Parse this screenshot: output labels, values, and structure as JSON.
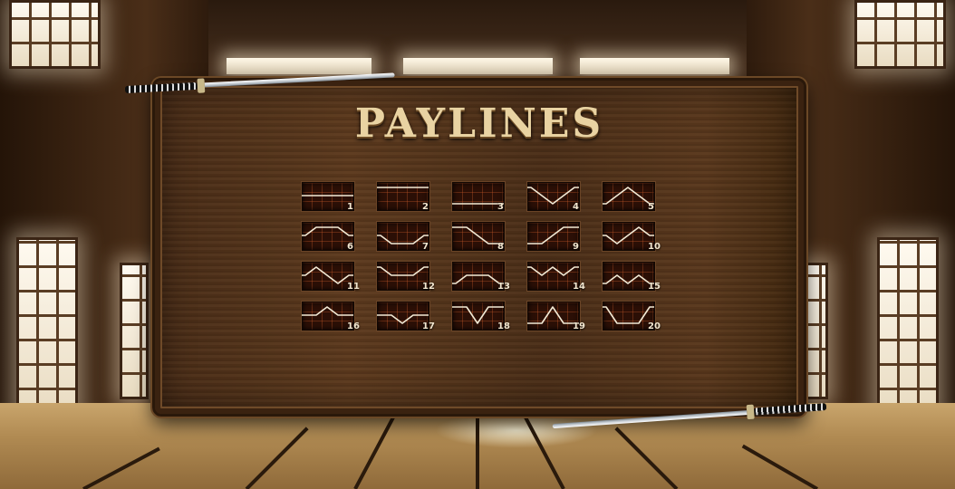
{
  "title": "PAYLINES",
  "colors": {
    "title": "#e9d3a2",
    "line": "#f3ead5",
    "box": "#2b0f06",
    "grid": "#c85a28"
  },
  "paylines": [
    {
      "label": "1",
      "pattern": [
        1,
        1,
        1,
        1,
        1
      ]
    },
    {
      "label": "2",
      "pattern": [
        0,
        0,
        0,
        0,
        0
      ]
    },
    {
      "label": "3",
      "pattern": [
        2,
        2,
        2,
        2,
        2
      ]
    },
    {
      "label": "4",
      "pattern": [
        0,
        1,
        2,
        1,
        0
      ]
    },
    {
      "label": "5",
      "pattern": [
        2,
        1,
        0,
        1,
        2
      ]
    },
    {
      "label": "6",
      "pattern": [
        1,
        0,
        0,
        0,
        1
      ]
    },
    {
      "label": "7",
      "pattern": [
        1,
        2,
        2,
        2,
        1
      ]
    },
    {
      "label": "8",
      "pattern": [
        0,
        0,
        1,
        2,
        2
      ]
    },
    {
      "label": "9",
      "pattern": [
        2,
        2,
        1,
        0,
        0
      ]
    },
    {
      "label": "10",
      "pattern": [
        1,
        2,
        1,
        0,
        1
      ]
    },
    {
      "label": "11",
      "pattern": [
        1,
        0,
        1,
        2,
        1
      ]
    },
    {
      "label": "12",
      "pattern": [
        0,
        1,
        1,
        1,
        0
      ]
    },
    {
      "label": "13",
      "pattern": [
        2,
        1,
        1,
        1,
        2
      ]
    },
    {
      "label": "14",
      "pattern": [
        0,
        1,
        0,
        1,
        0
      ]
    },
    {
      "label": "15",
      "pattern": [
        2,
        1,
        2,
        1,
        2
      ]
    },
    {
      "label": "16",
      "pattern": [
        1,
        1,
        0,
        1,
        1
      ]
    },
    {
      "label": "17",
      "pattern": [
        1,
        1,
        2,
        1,
        1
      ]
    },
    {
      "label": "18",
      "pattern": [
        0,
        0,
        2,
        0,
        0
      ]
    },
    {
      "label": "19",
      "pattern": [
        2,
        2,
        0,
        2,
        2
      ]
    },
    {
      "label": "20",
      "pattern": [
        0,
        2,
        2,
        2,
        0
      ]
    }
  ]
}
